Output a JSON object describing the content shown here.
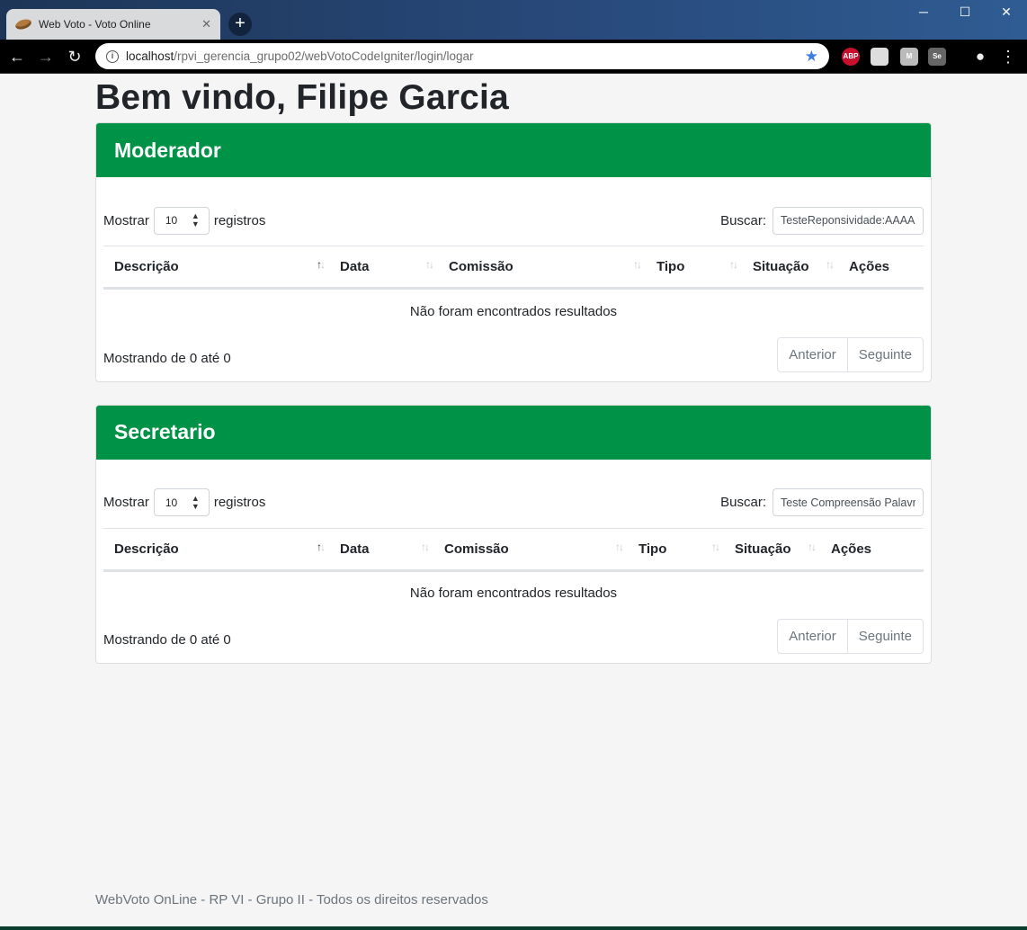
{
  "browser": {
    "tab_title": "Web Voto - Voto Online",
    "tab_close": "✕",
    "new_tab": "+",
    "url_host": "localhost",
    "url_path": "/rpvi_gerencia_grupo02/webVotoCodeIgniter/login/logar",
    "window_minimize": "─",
    "window_maximize": "☐",
    "window_close": "✕",
    "extensions": [
      "ABP",
      "",
      "M",
      "Se"
    ]
  },
  "page": {
    "welcome": "Bem vindo, Filipe Garcia",
    "footer": "WebVoto OnLine - RP VI - Grupo II - Todos os direitos reservados"
  },
  "panels": [
    {
      "title": "Moderador",
      "length_prefix": "Mostrar",
      "length_value": "10",
      "length_suffix": "registros",
      "search_label": "Buscar:",
      "search_value": "TesteReponsividade:AAAA",
      "columns": [
        "Descrição",
        "Data",
        "Comissão",
        "Tipo",
        "Situação",
        "Ações"
      ],
      "empty_message": "Não foram encontrados resultados",
      "info": "Mostrando de 0 até 0",
      "prev": "Anterior",
      "next": "Seguinte"
    },
    {
      "title": "Secretario",
      "length_prefix": "Mostrar",
      "length_value": "10",
      "length_suffix": "registros",
      "search_label": "Buscar:",
      "search_value": "Teste Compreensão Palavras",
      "columns": [
        "Descrição",
        "Data",
        "Comissão",
        "Tipo",
        "Situação",
        "Ações"
      ],
      "empty_message": "Não foram encontrados resultados",
      "info": "Mostrando de 0 até 0",
      "prev": "Anterior",
      "next": "Seguinte"
    }
  ],
  "colors": {
    "header_green": "#009246",
    "page_bg": "#f5f5f5",
    "muted_text": "#6c757d"
  }
}
